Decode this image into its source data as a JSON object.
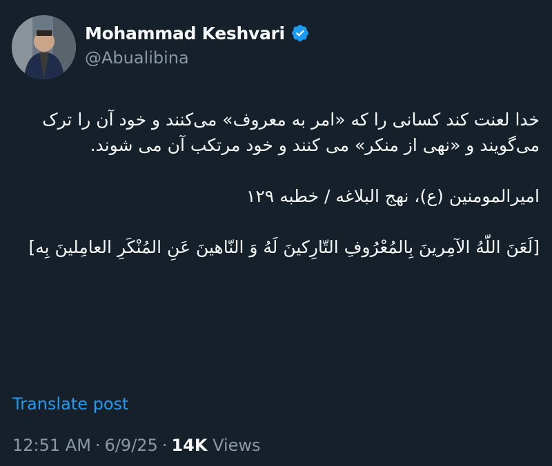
{
  "author": {
    "display_name": "Mohammad Keshvari",
    "handle": "@Abualibina",
    "verified": true
  },
  "post": {
    "paragraph1": "خدا لعنت کند کسانی را که «امر به معروف» می‌کنند و خود آن را ترک می‌گویند و «نهی از منکر» می کنند و خود مرتکب آن می شوند.",
    "paragraph2": "امیرالمومنین (ع)، نهج البلاغه / خطبه ۱۲۹",
    "paragraph3": "[لَعَنَ اللّهُ الآمِرينَ بِالمُعْرُوفِ التّارِكينَ لَهُ وَ النّاهينَ عَنِ المُنْكَرِ العامِلينَ بِه]"
  },
  "translate_label": "Translate post",
  "meta": {
    "time": "12:51 AM",
    "date": "6/9/25",
    "views_count": "14K",
    "views_label": "Views",
    "separator": "·"
  },
  "colors": {
    "background": "#15202b",
    "text": "#f7f9f9",
    "muted": "#8b98a5",
    "accent": "#1d9bf0"
  },
  "icons": {
    "verified": "verified-badge-icon",
    "avatar": "avatar"
  }
}
